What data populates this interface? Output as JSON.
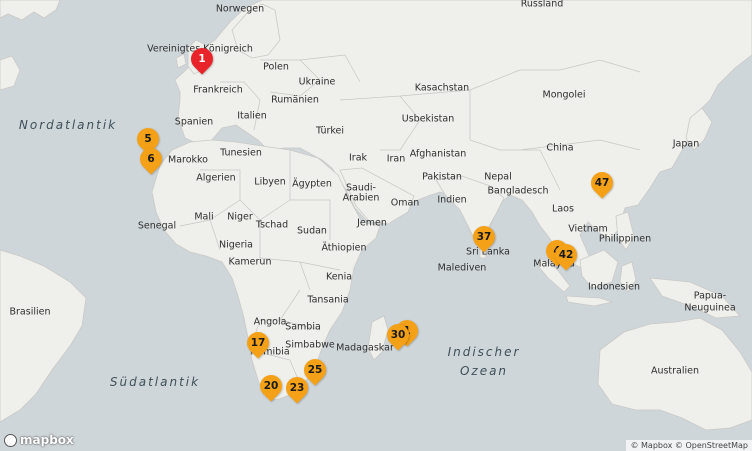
{
  "map": {
    "logo_text": "mapbox",
    "attribution": "© Mapbox © OpenStreetMap"
  },
  "labels": [
    {
      "text": "Russland"
    },
    {
      "text": "Norwegen"
    },
    {
      "text": "Vereinigtes Königreich"
    },
    {
      "text": "Polen"
    },
    {
      "text": "Ukraine"
    },
    {
      "text": "Kasachstan"
    },
    {
      "text": "Mongolei"
    },
    {
      "text": "Frankreich"
    },
    {
      "text": "Rumänien"
    },
    {
      "text": "Usbekistan"
    },
    {
      "text": "Spanien"
    },
    {
      "text": "Italien"
    },
    {
      "text": "Türkei"
    },
    {
      "text": "Japan"
    },
    {
      "text": "Marokko"
    },
    {
      "text": "Tunesien"
    },
    {
      "text": "Irak"
    },
    {
      "text": "Iran"
    },
    {
      "text": "Afghanistan"
    },
    {
      "text": "China"
    },
    {
      "text": "Algerien"
    },
    {
      "text": "Libyen"
    },
    {
      "text": "Ägypten"
    },
    {
      "text": "Saudi-"
    },
    {
      "text": "Arabien"
    },
    {
      "text": "Pakistan"
    },
    {
      "text": "Nepal"
    },
    {
      "text": "Bangladesch"
    },
    {
      "text": "Indien"
    },
    {
      "text": "Oman"
    },
    {
      "text": "Mali"
    },
    {
      "text": "Niger"
    },
    {
      "text": "Laos"
    },
    {
      "text": "Senegal"
    },
    {
      "text": "Tschad"
    },
    {
      "text": "Sudan"
    },
    {
      "text": "Jemen"
    },
    {
      "text": "Vietnam"
    },
    {
      "text": "Philippinen"
    },
    {
      "text": "Nigeria"
    },
    {
      "text": "Äthiopien"
    },
    {
      "text": "Sri Lanka"
    },
    {
      "text": "Kamerun"
    },
    {
      "text": "Kenia"
    },
    {
      "text": "Malaysia"
    },
    {
      "text": "Malediven"
    },
    {
      "text": "Indonesien"
    },
    {
      "text": "Tansania"
    },
    {
      "text": "Papua-"
    },
    {
      "text": "Neuguinea"
    },
    {
      "text": "Brasilien"
    },
    {
      "text": "Angola"
    },
    {
      "text": "Sambia"
    },
    {
      "text": "Simbabwe"
    },
    {
      "text": "Madagaskar"
    },
    {
      "text": "Namibia"
    },
    {
      "text": "Australien"
    }
  ],
  "oceans": [
    {
      "text": "Nordatlantik"
    },
    {
      "text": "Indischer"
    },
    {
      "text": "Ozean"
    },
    {
      "text": "Südatlantik"
    }
  ],
  "markers": [
    {
      "num": "1",
      "color": "#e8242a"
    },
    {
      "num": "5",
      "color": "#f5a117"
    },
    {
      "num": "6",
      "color": "#f5a117"
    },
    {
      "num": "47",
      "color": "#f5a117"
    },
    {
      "num": "37",
      "color": "#f5a117"
    },
    {
      "num": "4",
      "color": "#f5a117"
    },
    {
      "num": "42",
      "color": "#f5a117"
    },
    {
      "num": "1",
      "color": "#f5a117"
    },
    {
      "num": "30",
      "color": "#f5a117"
    },
    {
      "num": "17",
      "color": "#f5a117"
    },
    {
      "num": "25",
      "color": "#f5a117"
    },
    {
      "num": "20",
      "color": "#f5a117"
    },
    {
      "num": "23",
      "color": "#f5a117"
    }
  ]
}
